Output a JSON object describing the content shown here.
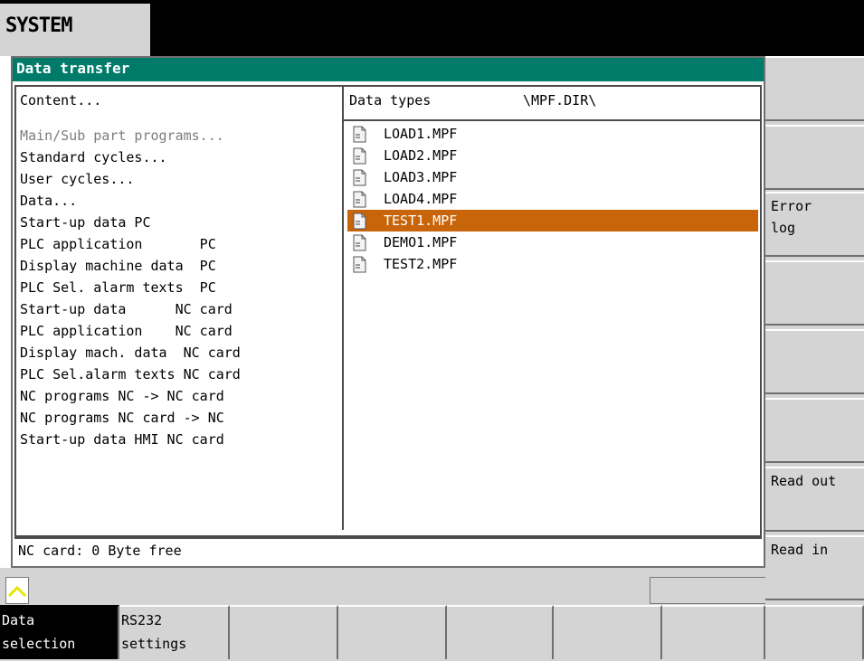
{
  "header": {
    "area_label": "SYSTEM"
  },
  "dialog": {
    "title": "Data transfer",
    "content_header": "Content...",
    "types_header": "Data types",
    "dir_label": "\\MPF.DIR\\",
    "content_items": [
      "Main/Sub part programs...",
      "Standard cycles...",
      "User cycles...",
      "Data...",
      "Start-up data PC",
      "PLC application       PC",
      "Display machine data  PC",
      "PLC Sel. alarm texts  PC",
      "Start-up data      NC card",
      "PLC application    NC card",
      "Display mach. data  NC card",
      "PLC Sel.alarm texts NC card",
      "NC programs NC -> NC card",
      "NC programs NC card -> NC",
      "Start-up data HMI NC card"
    ],
    "files": [
      "LOAD1.MPF",
      "LOAD2.MPF",
      "LOAD3.MPF",
      "LOAD4.MPF",
      "TEST1.MPF",
      "DEMO1.MPF",
      "TEST2.MPF"
    ],
    "selected_file": "TEST1.MPF",
    "status": "NC card: 0 Byte free"
  },
  "softkeys_vertical": [
    {
      "line1": "",
      "line2": ""
    },
    {
      "line1": "",
      "line2": ""
    },
    {
      "line1": "Error",
      "line2": "log"
    },
    {
      "line1": "",
      "line2": ""
    },
    {
      "line1": "",
      "line2": ""
    },
    {
      "line1": "",
      "line2": ""
    },
    {
      "line1": "Read out",
      "line2": ""
    },
    {
      "line1": "Read in",
      "line2": ""
    }
  ],
  "softkeys_horizontal": [
    {
      "line1": "Data",
      "line2": "selection"
    },
    {
      "line1": "RS232",
      "line2": "settings"
    },
    {
      "line1": "",
      "line2": ""
    },
    {
      "line1": "",
      "line2": ""
    },
    {
      "line1": "",
      "line2": ""
    },
    {
      "line1": "",
      "line2": ""
    },
    {
      "line1": "",
      "line2": ""
    },
    {
      "line1": "",
      "line2": ""
    }
  ],
  "icons": {
    "caret": "chevron-up-icon",
    "file": "document-icon"
  },
  "colors": {
    "title_bar": "#007b6a",
    "selection": "#c8640a",
    "panel": "#d4d4d4",
    "caret": "#e6e600"
  }
}
